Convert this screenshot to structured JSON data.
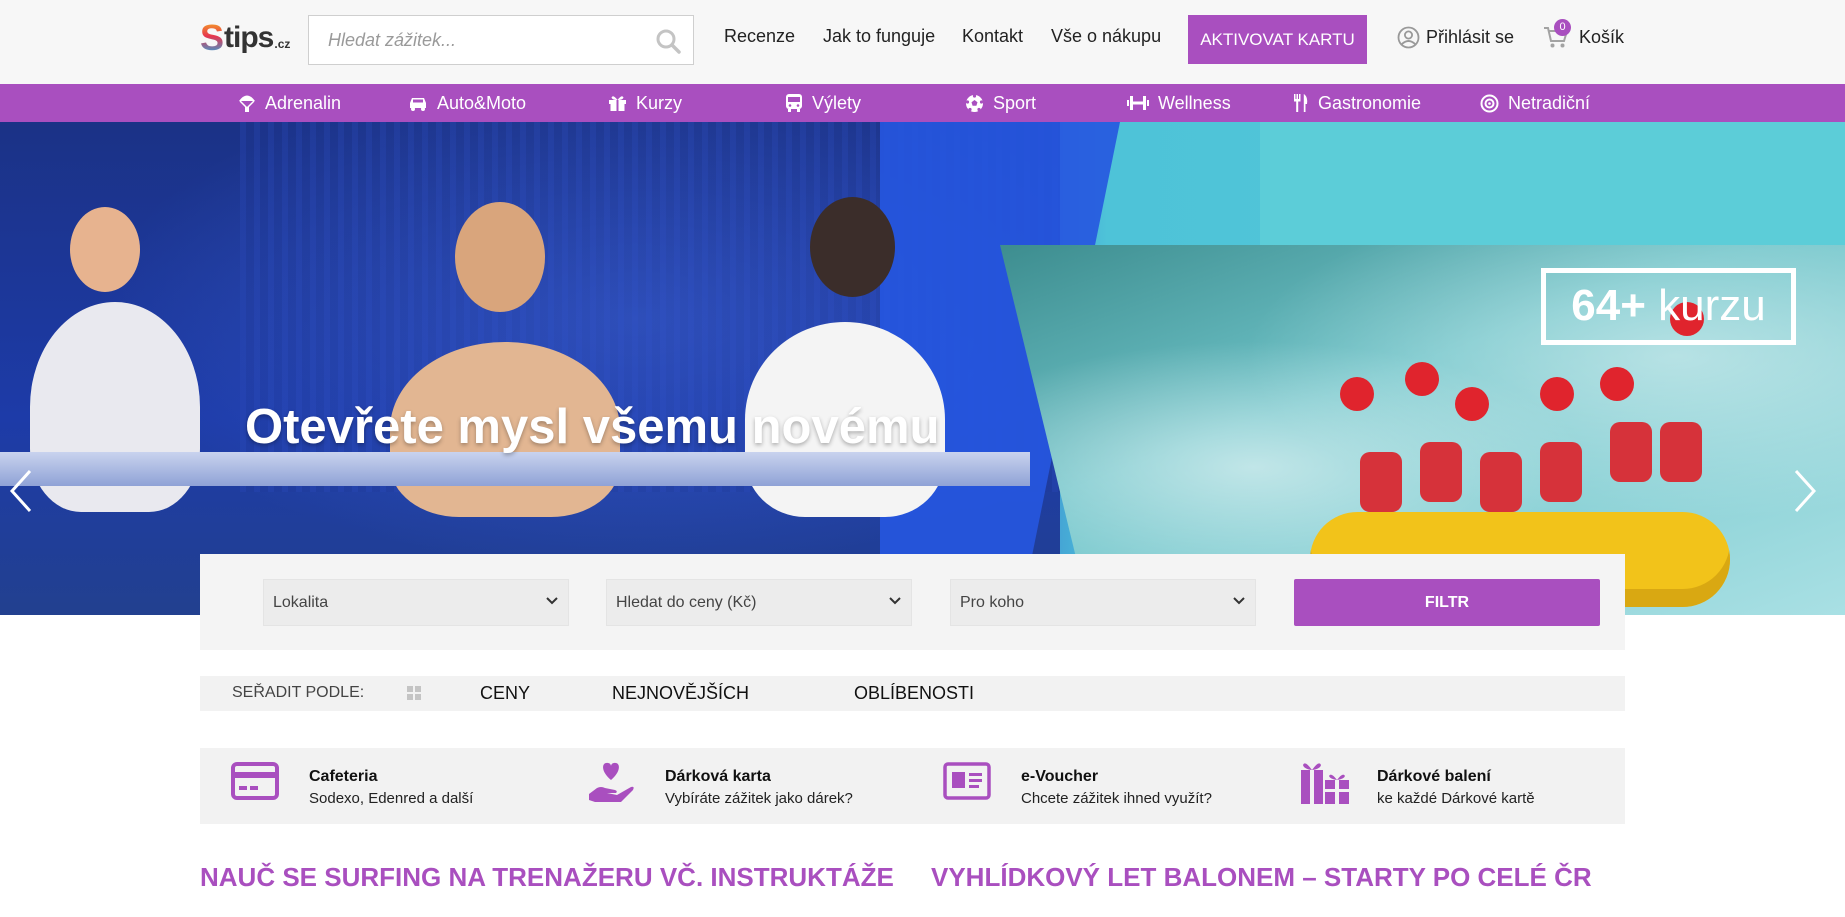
{
  "logo": {
    "s": "S",
    "main": "tips",
    "suffix": ".cz"
  },
  "search": {
    "placeholder": "Hledat zážitek..."
  },
  "topnav": [
    {
      "label": "Recenze"
    },
    {
      "label": "Jak to funguje"
    },
    {
      "label": "Kontakt"
    },
    {
      "label": "Vše o nákupu"
    }
  ],
  "activate_label": "AKTIVOVAT KARTU",
  "login_label": "Přihlásit se",
  "cart": {
    "label": "Košík",
    "count": "0"
  },
  "categories": [
    {
      "label": "Adrenalin",
      "icon": "parachute-icon"
    },
    {
      "label": "Auto&Moto",
      "icon": "car-icon"
    },
    {
      "label": "Kurzy",
      "icon": "gift-icon"
    },
    {
      "label": "Výlety",
      "icon": "bus-icon"
    },
    {
      "label": "Sport",
      "icon": "football-icon"
    },
    {
      "label": "Wellness",
      "icon": "dumbbell-icon"
    },
    {
      "label": "Gastronomie",
      "icon": "fork-knife-icon"
    },
    {
      "label": "Netradiční",
      "icon": "target-icon"
    }
  ],
  "hero": {
    "badge_number": "64+",
    "badge_text": "kurzu",
    "title": "Otevřete mysl všemu novému"
  },
  "filter": {
    "location": "Lokalita",
    "price": "Hledat do ceny (Kč)",
    "for_whom": "Pro koho",
    "button": "FILTR"
  },
  "sort": {
    "label": "SEŘADIT PODLE:",
    "options": [
      "CENY",
      "NEJNOVĚJŠÍCH",
      "OBLÍBENOSTI"
    ]
  },
  "features": [
    {
      "title": "Cafeteria",
      "subtitle": "Sodexo, Edenred a další",
      "icon": "credit-card-icon"
    },
    {
      "title": "Dárková karta",
      "subtitle": "Vybíráte zážitek jako dárek?",
      "icon": "heart-hand-icon"
    },
    {
      "title": "e-Voucher",
      "subtitle": "Chcete zážitek ihned využít?",
      "icon": "id-card-icon"
    },
    {
      "title": "Dárkové balení",
      "subtitle": "ke každé Dárkové kartě",
      "icon": "gift-boxes-icon"
    }
  ],
  "products": [
    {
      "title": "NAUČ SE SURFING NA TRENAŽERU VČ. INSTRUKTÁŽE"
    },
    {
      "title": "VYHLÍDKOVÝ LET BALONEM – STARTY PO CELÉ ČR"
    }
  ],
  "colors": {
    "brand": "#a94fbf",
    "header_bg": "#f7f7f7",
    "panel_bg": "#f4f4f4"
  }
}
